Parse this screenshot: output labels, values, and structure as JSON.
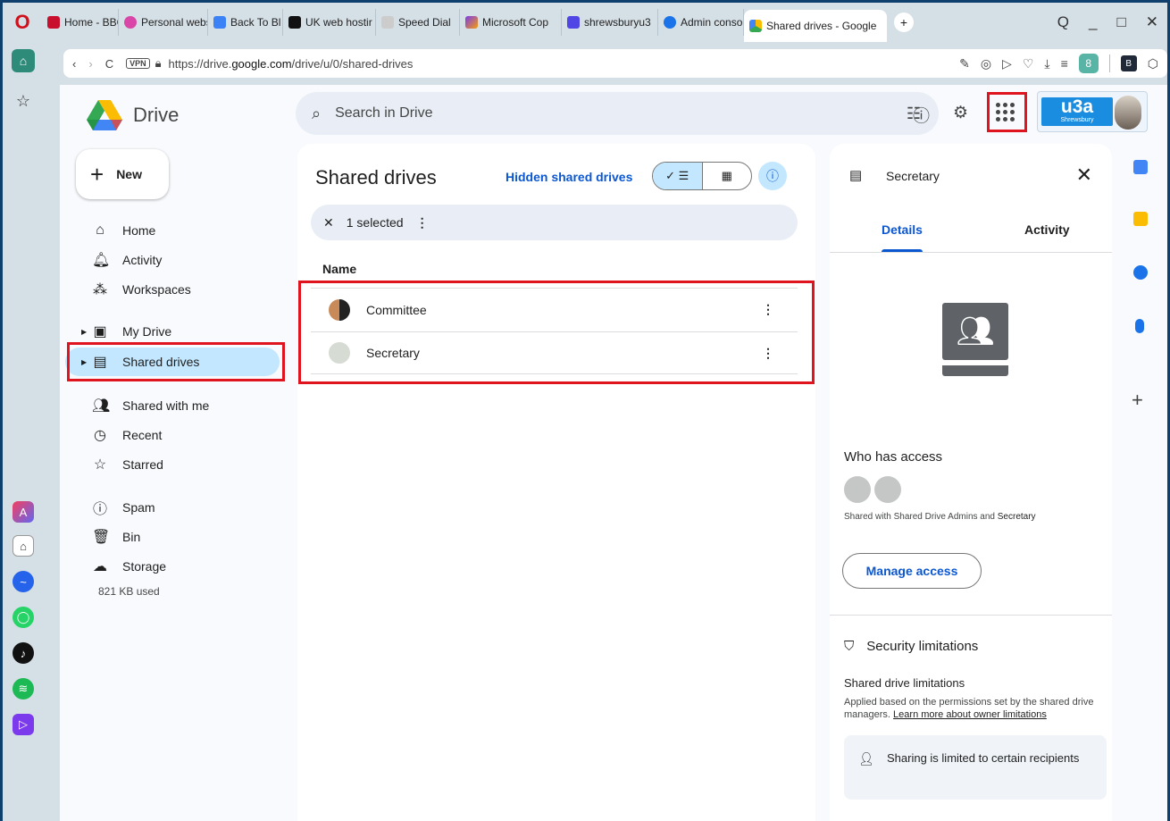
{
  "browser": {
    "opera_logo": "O",
    "tabs": [
      {
        "label": "Home - BBC N",
        "color": "#c8102e"
      },
      {
        "label": "Personal webs",
        "color": "#d946a8"
      },
      {
        "label": "Back To Bl",
        "color": "#3b82f6"
      },
      {
        "label": "UK web hostir",
        "color": "#111111"
      },
      {
        "label": "Speed Dial",
        "color": "#777777"
      },
      {
        "label": "Microsoft Cop",
        "color": "#7c3aed"
      },
      {
        "label": "shrewsburyu3",
        "color": "#4f46e5"
      },
      {
        "label": "Admin consol",
        "color": "#1a73e8"
      },
      {
        "label": "Shared drives - Google",
        "color": "#fbbc04"
      }
    ],
    "new_tab": "+",
    "window_controls": [
      "Q",
      "_",
      "□",
      "✕"
    ],
    "address": {
      "vpn": "VPN",
      "url_prefix": "https://drive.",
      "url_host": "google.com",
      "url_path": "/drive/u/0/shared-drives",
      "profile_initial": "8"
    }
  },
  "drive": {
    "logo_text": "Drive",
    "search_placeholder": "Search in Drive",
    "new_label": "New",
    "nav": {
      "home": "Home",
      "activity": "Activity",
      "workspaces": "Workspaces",
      "my_drive": "My Drive",
      "shared_drives": "Shared drives",
      "shared_with_me": "Shared with me",
      "recent": "Recent",
      "starred": "Starred",
      "spam": "Spam",
      "bin": "Bin",
      "storage": "Storage"
    },
    "storage_used": "821 KB used",
    "account_badge": {
      "main": "u3a",
      "sub": "Shrewsbury"
    }
  },
  "main": {
    "title": "Shared drives",
    "hidden_link": "Hidden shared drives",
    "selection": {
      "count_label": "1 selected"
    },
    "column_name": "Name",
    "rows": [
      {
        "name": "Committee"
      },
      {
        "name": "Secretary"
      }
    ]
  },
  "details": {
    "title": "Secretary",
    "tabs": {
      "details": "Details",
      "activity": "Activity"
    },
    "who_has_access": "Who has access",
    "shared_with_prefix": "Shared with Shared Drive Admins and",
    "shared_with_name": "Secretary",
    "manage_access": "Manage access",
    "security_title": "Security limitations",
    "limitations_title": "Shared drive limitations",
    "limitations_text": "Applied based on the permissions set by the shared drive managers.",
    "limitations_link": "Learn more about owner limitations",
    "limit_box": "Sharing is limited to certain recipients"
  }
}
